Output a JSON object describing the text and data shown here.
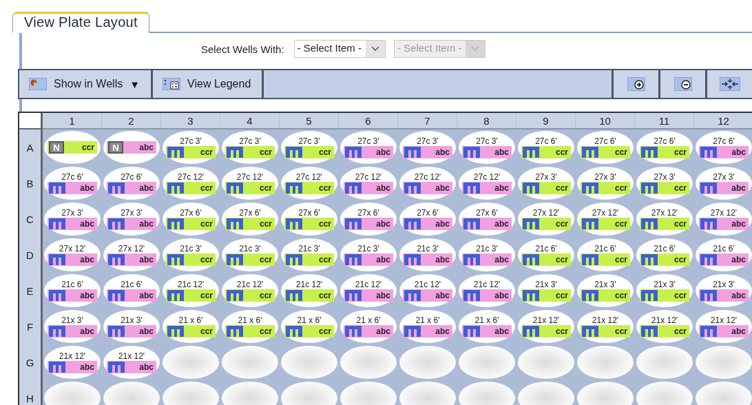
{
  "tab": {
    "label": "View Plate Layout",
    "selected": true
  },
  "select_wells": {
    "label": "Select Wells With:",
    "dropdowns": [
      {
        "value": "- Select Item -",
        "disabled": false
      },
      {
        "value": "- Select Item -",
        "disabled": true
      }
    ]
  },
  "toolbar": {
    "show_in_wells": {
      "label": "Show in Wells",
      "caret": "▼"
    },
    "view_legend": {
      "label": "View Legend"
    }
  },
  "plate": {
    "columns": [
      "1",
      "2",
      "3",
      "4",
      "5",
      "6",
      "7",
      "8",
      "9",
      "10",
      "11",
      "12"
    ],
    "rows": [
      {
        "label": "A",
        "wells": [
          {
            "kind": "control",
            "badge": "N",
            "group": "ccr",
            "color": "#c8f04c"
          },
          {
            "kind": "control",
            "badge": "N",
            "group": "abc",
            "color": "#f2a0e2"
          },
          {
            "kind": "sample",
            "title": "27c 3'",
            "group": "ccr",
            "color": "#c8f04c"
          },
          {
            "kind": "sample",
            "title": "27c 3'",
            "group": "ccr",
            "color": "#c8f04c"
          },
          {
            "kind": "sample",
            "title": "27c 3'",
            "group": "ccr",
            "color": "#c8f04c"
          },
          {
            "kind": "sample",
            "title": "27c 3'",
            "group": "abc",
            "color": "#f2a0e2"
          },
          {
            "kind": "sample",
            "title": "27c 3'",
            "group": "abc",
            "color": "#f2a0e2"
          },
          {
            "kind": "sample",
            "title": "27c 3'",
            "group": "abc",
            "color": "#f2a0e2"
          },
          {
            "kind": "sample",
            "title": "27c 6'",
            "group": "ccr",
            "color": "#c8f04c"
          },
          {
            "kind": "sample",
            "title": "27c 6'",
            "group": "ccr",
            "color": "#c8f04c"
          },
          {
            "kind": "sample",
            "title": "27c 6'",
            "group": "ccr",
            "color": "#c8f04c"
          },
          {
            "kind": "sample",
            "title": "27c 6'",
            "group": "abc",
            "color": "#f2a0e2"
          }
        ]
      },
      {
        "label": "B",
        "wells": [
          {
            "kind": "sample",
            "title": "27c 6'",
            "group": "abc",
            "color": "#f2a0e2"
          },
          {
            "kind": "sample",
            "title": "27c 6'",
            "group": "abc",
            "color": "#f2a0e2"
          },
          {
            "kind": "sample",
            "title": "27c 12'",
            "group": "ccr",
            "color": "#c8f04c"
          },
          {
            "kind": "sample",
            "title": "27c 12'",
            "group": "ccr",
            "color": "#c8f04c"
          },
          {
            "kind": "sample",
            "title": "27c 12'",
            "group": "ccr",
            "color": "#c8f04c"
          },
          {
            "kind": "sample",
            "title": "27c 12'",
            "group": "abc",
            "color": "#f2a0e2"
          },
          {
            "kind": "sample",
            "title": "27c 12'",
            "group": "abc",
            "color": "#f2a0e2"
          },
          {
            "kind": "sample",
            "title": "27c 12'",
            "group": "abc",
            "color": "#f2a0e2"
          },
          {
            "kind": "sample",
            "title": "27x 3'",
            "group": "ccr",
            "color": "#c8f04c"
          },
          {
            "kind": "sample",
            "title": "27x 3'",
            "group": "ccr",
            "color": "#c8f04c"
          },
          {
            "kind": "sample",
            "title": "27x 3'",
            "group": "ccr",
            "color": "#c8f04c"
          },
          {
            "kind": "sample",
            "title": "27x 3'",
            "group": "abc",
            "color": "#f2a0e2"
          }
        ]
      },
      {
        "label": "C",
        "wells": [
          {
            "kind": "sample",
            "title": "27x 3'",
            "group": "abc",
            "color": "#f2a0e2"
          },
          {
            "kind": "sample",
            "title": "27x 3'",
            "group": "abc",
            "color": "#f2a0e2"
          },
          {
            "kind": "sample",
            "title": "27x 6'",
            "group": "ccr",
            "color": "#c8f04c"
          },
          {
            "kind": "sample",
            "title": "27x 6'",
            "group": "ccr",
            "color": "#c8f04c"
          },
          {
            "kind": "sample",
            "title": "27x 6'",
            "group": "ccr",
            "color": "#c8f04c"
          },
          {
            "kind": "sample",
            "title": "27x 6'",
            "group": "abc",
            "color": "#f2a0e2"
          },
          {
            "kind": "sample",
            "title": "27x 6'",
            "group": "abc",
            "color": "#f2a0e2"
          },
          {
            "kind": "sample",
            "title": "27x 6'",
            "group": "abc",
            "color": "#f2a0e2"
          },
          {
            "kind": "sample",
            "title": "27x 12'",
            "group": "ccr",
            "color": "#c8f04c"
          },
          {
            "kind": "sample",
            "title": "27x 12'",
            "group": "ccr",
            "color": "#c8f04c"
          },
          {
            "kind": "sample",
            "title": "27x 12'",
            "group": "ccr",
            "color": "#c8f04c"
          },
          {
            "kind": "sample",
            "title": "27x 12'",
            "group": "abc",
            "color": "#f2a0e2"
          }
        ]
      },
      {
        "label": "D",
        "wells": [
          {
            "kind": "sample",
            "title": "27x 12'",
            "group": "abc",
            "color": "#f2a0e2"
          },
          {
            "kind": "sample",
            "title": "27x 12'",
            "group": "abc",
            "color": "#f2a0e2"
          },
          {
            "kind": "sample",
            "title": "21c 3'",
            "group": "ccr",
            "color": "#c8f04c"
          },
          {
            "kind": "sample",
            "title": "21c 3'",
            "group": "ccr",
            "color": "#c8f04c"
          },
          {
            "kind": "sample",
            "title": "21c 3'",
            "group": "ccr",
            "color": "#c8f04c"
          },
          {
            "kind": "sample",
            "title": "21c 3'",
            "group": "abc",
            "color": "#f2a0e2"
          },
          {
            "kind": "sample",
            "title": "21c 3'",
            "group": "abc",
            "color": "#f2a0e2"
          },
          {
            "kind": "sample",
            "title": "21c 3'",
            "group": "abc",
            "color": "#f2a0e2"
          },
          {
            "kind": "sample",
            "title": "21c 6'",
            "group": "ccr",
            "color": "#c8f04c"
          },
          {
            "kind": "sample",
            "title": "21c 6'",
            "group": "ccr",
            "color": "#c8f04c"
          },
          {
            "kind": "sample",
            "title": "21c 6'",
            "group": "ccr",
            "color": "#c8f04c"
          },
          {
            "kind": "sample",
            "title": "21c 6'",
            "group": "abc",
            "color": "#f2a0e2"
          }
        ]
      },
      {
        "label": "E",
        "wells": [
          {
            "kind": "sample",
            "title": "21c 6'",
            "group": "abc",
            "color": "#f2a0e2"
          },
          {
            "kind": "sample",
            "title": "21c 6'",
            "group": "abc",
            "color": "#f2a0e2"
          },
          {
            "kind": "sample",
            "title": "21c 12'",
            "group": "ccr",
            "color": "#c8f04c"
          },
          {
            "kind": "sample",
            "title": "21c 12'",
            "group": "ccr",
            "color": "#c8f04c"
          },
          {
            "kind": "sample",
            "title": "21c 12'",
            "group": "ccr",
            "color": "#c8f04c"
          },
          {
            "kind": "sample",
            "title": "21c 12'",
            "group": "abc",
            "color": "#f2a0e2"
          },
          {
            "kind": "sample",
            "title": "21c 12'",
            "group": "abc",
            "color": "#f2a0e2"
          },
          {
            "kind": "sample",
            "title": "21c 12'",
            "group": "abc",
            "color": "#f2a0e2"
          },
          {
            "kind": "sample",
            "title": "21x 3'",
            "group": "ccr",
            "color": "#c8f04c"
          },
          {
            "kind": "sample",
            "title": "21x 3'",
            "group": "ccr",
            "color": "#c8f04c"
          },
          {
            "kind": "sample",
            "title": "21x 3'",
            "group": "ccr",
            "color": "#c8f04c"
          },
          {
            "kind": "sample",
            "title": "21x 3'",
            "group": "abc",
            "color": "#f2a0e2"
          }
        ]
      },
      {
        "label": "F",
        "wells": [
          {
            "kind": "sample",
            "title": "21x 3'",
            "group": "abc",
            "color": "#f2a0e2"
          },
          {
            "kind": "sample",
            "title": "21x 3'",
            "group": "abc",
            "color": "#f2a0e2"
          },
          {
            "kind": "sample",
            "title": "21 x 6'",
            "group": "ccr",
            "color": "#c8f04c"
          },
          {
            "kind": "sample",
            "title": "21 x 6'",
            "group": "ccr",
            "color": "#c8f04c"
          },
          {
            "kind": "sample",
            "title": "21 x 6'",
            "group": "ccr",
            "color": "#c8f04c"
          },
          {
            "kind": "sample",
            "title": "21 x 6'",
            "group": "abc",
            "color": "#f2a0e2"
          },
          {
            "kind": "sample",
            "title": "21 x 6'",
            "group": "abc",
            "color": "#f2a0e2"
          },
          {
            "kind": "sample",
            "title": "21 x 6'",
            "group": "abc",
            "color": "#f2a0e2"
          },
          {
            "kind": "sample",
            "title": "21x 12'",
            "group": "ccr",
            "color": "#c8f04c"
          },
          {
            "kind": "sample",
            "title": "21x 12'",
            "group": "ccr",
            "color": "#c8f04c"
          },
          {
            "kind": "sample",
            "title": "21x 12'",
            "group": "ccr",
            "color": "#c8f04c"
          },
          {
            "kind": "sample",
            "title": "21x 12'",
            "group": "abc",
            "color": "#f2a0e2"
          }
        ]
      },
      {
        "label": "G",
        "wells": [
          {
            "kind": "sample",
            "title": "21x 12'",
            "group": "abc",
            "color": "#f2a0e2"
          },
          {
            "kind": "sample",
            "title": "21x 12'",
            "group": "abc",
            "color": "#f2a0e2"
          },
          {
            "kind": "empty"
          },
          {
            "kind": "empty"
          },
          {
            "kind": "empty"
          },
          {
            "kind": "empty"
          },
          {
            "kind": "empty"
          },
          {
            "kind": "empty"
          },
          {
            "kind": "empty"
          },
          {
            "kind": "empty"
          },
          {
            "kind": "empty"
          },
          {
            "kind": "empty"
          }
        ]
      },
      {
        "label": "H",
        "wells": [
          {
            "kind": "empty"
          },
          {
            "kind": "empty"
          },
          {
            "kind": "empty"
          },
          {
            "kind": "empty"
          },
          {
            "kind": "empty"
          },
          {
            "kind": "empty"
          },
          {
            "kind": "empty"
          },
          {
            "kind": "empty"
          },
          {
            "kind": "empty"
          },
          {
            "kind": "empty"
          },
          {
            "kind": "empty"
          },
          {
            "kind": "empty"
          }
        ]
      }
    ]
  }
}
